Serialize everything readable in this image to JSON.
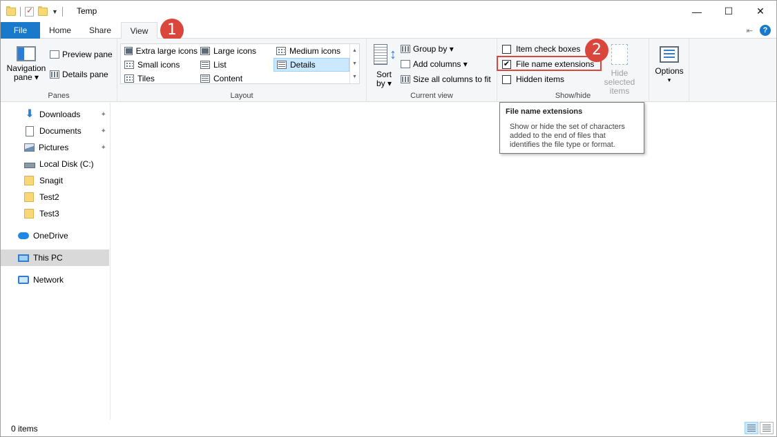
{
  "window": {
    "title": "Temp",
    "controls": {
      "minimize": "—",
      "maximize": "☐",
      "close": "✕"
    }
  },
  "tabs": {
    "file": "File",
    "home": "Home",
    "share": "Share",
    "view": "View",
    "help": "?"
  },
  "badges": [
    "1",
    "2"
  ],
  "ribbon": {
    "panes": {
      "label": "Panes",
      "navigation_pane_line1": "Navigation",
      "navigation_pane_line2": "pane ▾",
      "preview_pane": "Preview pane",
      "details_pane": "Details pane"
    },
    "layout": {
      "label": "Layout",
      "items": [
        "Extra large icons",
        "Large icons",
        "Medium icons",
        "Small icons",
        "List",
        "Details",
        "Tiles",
        "Content"
      ],
      "selected": "Details"
    },
    "current_view": {
      "label": "Current view",
      "sort_line1": "Sort",
      "sort_line2": "by ▾",
      "group_by": "Group by ▾",
      "add_columns": "Add columns ▾",
      "size_columns": "Size all columns to fit"
    },
    "show_hide": {
      "label": "Show/hide",
      "item_check_boxes": "Item check boxes",
      "file_name_extensions": "File name extensions",
      "hidden_items": "Hidden items",
      "hide_selected_line1": "Hide selected",
      "hide_selected_line2": "items",
      "checks": {
        "item_check_boxes": "",
        "file_name_extensions": "✔",
        "hidden_items": ""
      }
    },
    "options": {
      "label": "Options",
      "arrow": "▾"
    }
  },
  "tooltip": {
    "title": "File name extensions",
    "body_line1": "Show or hide the set of characters",
    "body_line2": "added to the end of files that",
    "body_line3": "identifies the file type or format."
  },
  "nav": {
    "items": [
      {
        "label": "Downloads",
        "pinned": true
      },
      {
        "label": "Documents",
        "pinned": true
      },
      {
        "label": "Pictures",
        "pinned": true
      },
      {
        "label": "Local Disk (C:)"
      },
      {
        "label": "Snagit"
      },
      {
        "label": "Test2"
      },
      {
        "label": "Test3"
      },
      {
        "label": "OneDrive"
      },
      {
        "label": "This PC",
        "selected": true
      },
      {
        "label": "Network"
      }
    ]
  },
  "status": {
    "item_count": "0 items"
  },
  "colors": {
    "accent": "#1979ca",
    "badge": "#d9463b",
    "selection": "#cce8ff"
  }
}
